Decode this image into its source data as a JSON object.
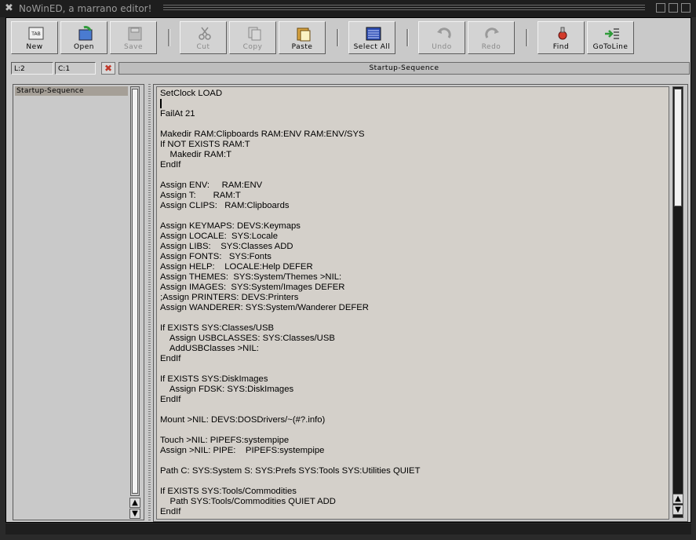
{
  "window": {
    "title": "NoWinED, a marrano editor!",
    "close_glyph": "✖"
  },
  "toolbar": {
    "buttons": [
      {
        "label": "New",
        "icon": "tab-new-icon",
        "enabled": true
      },
      {
        "label": "Open",
        "icon": "open-icon",
        "enabled": true
      },
      {
        "label": "Save",
        "icon": "floppy-icon",
        "enabled": false
      },
      {
        "label": "Cut",
        "icon": "scissors-icon",
        "enabled": false
      },
      {
        "label": "Copy",
        "icon": "copy-icon",
        "enabled": false
      },
      {
        "label": "Paste",
        "icon": "paste-icon",
        "enabled": true
      },
      {
        "label": "Select All",
        "icon": "select-all-icon",
        "enabled": true
      },
      {
        "label": "Undo",
        "icon": "undo-icon",
        "enabled": false
      },
      {
        "label": "Redo",
        "icon": "redo-icon",
        "enabled": false
      },
      {
        "label": "Find",
        "icon": "find-icon",
        "enabled": true
      },
      {
        "label": "GoToLine",
        "icon": "goto-line-icon",
        "enabled": true
      }
    ],
    "new_icon_text": "TAB"
  },
  "status": {
    "line": "L:2",
    "column": "C:1",
    "filename": "Startup-Sequence"
  },
  "sidebar": {
    "items": [
      "Startup-Sequence"
    ]
  },
  "editor": {
    "lines": [
      "SetClock LOAD",
      "",
      "FailAt 21",
      "",
      "Makedir RAM:Clipboards RAM:ENV RAM:ENV/SYS",
      "If NOT EXISTS RAM:T",
      "    Makedir RAM:T",
      "EndIf",
      "",
      "Assign ENV:     RAM:ENV",
      "Assign T:       RAM:T",
      "Assign CLIPS:   RAM:Clipboards",
      "",
      "Assign KEYMAPS: DEVS:Keymaps",
      "Assign LOCALE:  SYS:Locale",
      "Assign LIBS:    SYS:Classes ADD",
      "Assign FONTS:   SYS:Fonts",
      "Assign HELP:    LOCALE:Help DEFER",
      "Assign THEMES:  SYS:System/Themes >NIL:",
      "Assign IMAGES:  SYS:System/Images DEFER",
      ";Assign PRINTERS: DEVS:Printers",
      "Assign WANDERER: SYS:System/Wanderer DEFER",
      "",
      "If EXISTS SYS:Classes/USB",
      "    Assign USBCLASSES: SYS:Classes/USB",
      "    AddUSBClasses >NIL:",
      "EndIf",
      "",
      "If EXISTS SYS:DiskImages",
      "    Assign FDSK: SYS:DiskImages",
      "EndIf",
      "",
      "Mount >NIL: DEVS:DOSDrivers/~(#?.info)",
      "",
      "Touch >NIL: PIPEFS:systempipe",
      "Assign >NIL: PIPE:    PIPEFS:systempipe",
      "",
      "Path C: SYS:System S: SYS:Prefs SYS:Tools SYS:Utilities QUIET",
      "",
      "If EXISTS SYS:Tools/Commodities",
      "    Path SYS:Tools/Commodities QUIET ADD",
      "EndIf"
    ]
  },
  "scroll": {
    "up_glyph": "▲",
    "down_glyph": "▼"
  }
}
